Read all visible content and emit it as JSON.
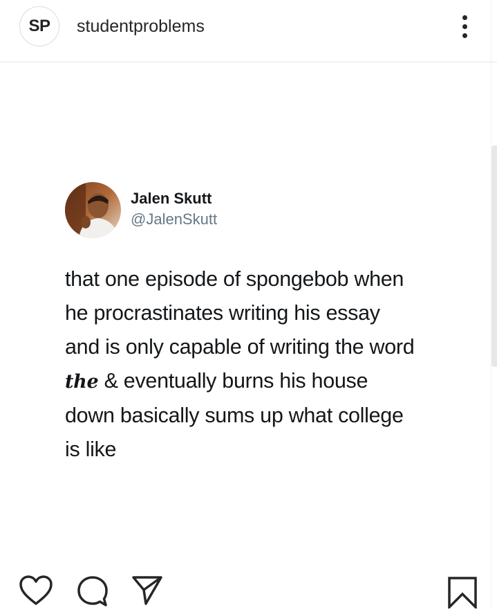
{
  "header": {
    "avatar_initials": "SP",
    "username": "studentproblems",
    "more_icon": "more-vertical-icon"
  },
  "tweet": {
    "display_name": "Jalen Skutt",
    "handle": "@JalenSkutt",
    "lines": [
      "that one episode of spongebob when",
      "he procrastinates writing his essay",
      "and is only capable of writing the word",
      "& eventually burns his house",
      "down basically sums up what college",
      "is like"
    ],
    "stylized_word": "the"
  },
  "actions": {
    "like_icon": "heart-icon",
    "comment_icon": "comment-icon",
    "share_icon": "send-icon",
    "save_icon": "bookmark-icon"
  },
  "colors": {
    "text": "#262626",
    "tweet_text": "#14171a",
    "handle": "#657786",
    "divider": "#e6e6e6"
  }
}
